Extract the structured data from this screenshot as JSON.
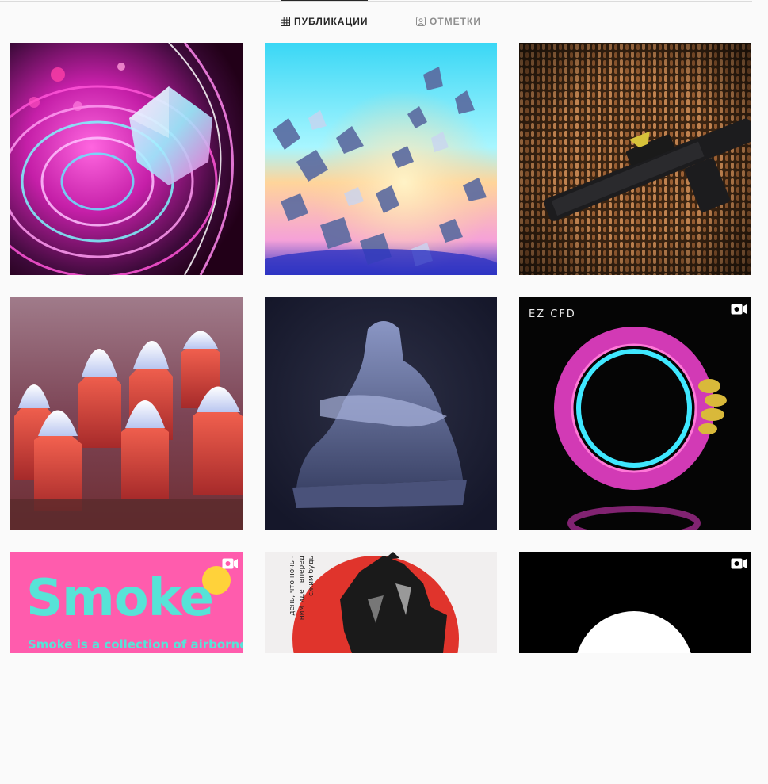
{
  "tabs": {
    "posts_label": "ПУБЛИКАЦИИ",
    "tagged_label": "ОТМЕТКИ"
  },
  "posts": [
    {
      "id": "post-1",
      "video": false,
      "description": "pink neon swirl with crystal"
    },
    {
      "id": "post-2",
      "video": false,
      "description": "crystal shards explosion"
    },
    {
      "id": "post-3",
      "video": false,
      "description": "rifle on bullets"
    },
    {
      "id": "post-4",
      "video": false,
      "description": "pink white flower buds"
    },
    {
      "id": "post-5",
      "video": false,
      "description": "pieta statue"
    },
    {
      "id": "post-6",
      "video": true,
      "brand": "EZ CFD",
      "brand_sub": "EZ CFD",
      "description": "neon ring"
    },
    {
      "id": "post-7",
      "video": true,
      "title": "Smoke",
      "subtitle": "Smoke is a collection of airborne",
      "description": "pink smoke card"
    },
    {
      "id": "post-8",
      "video": false,
      "caption_line1": "день, что ночь -",
      "caption_line2": "ним идет вперед",
      "caption_line3": "сжим будь",
      "description": "red splash figure"
    },
    {
      "id": "post-9",
      "video": true,
      "description": "white circle on black"
    }
  ],
  "colors": {
    "background": "#fafafa",
    "active_tab": "#262626",
    "inactive_tab": "#8e8e8e",
    "divider": "#dbdbdb"
  },
  "icons": {
    "posts_tab": "grid-icon",
    "tagged_tab": "tagged-user-icon",
    "video_badge": "video-icon"
  }
}
